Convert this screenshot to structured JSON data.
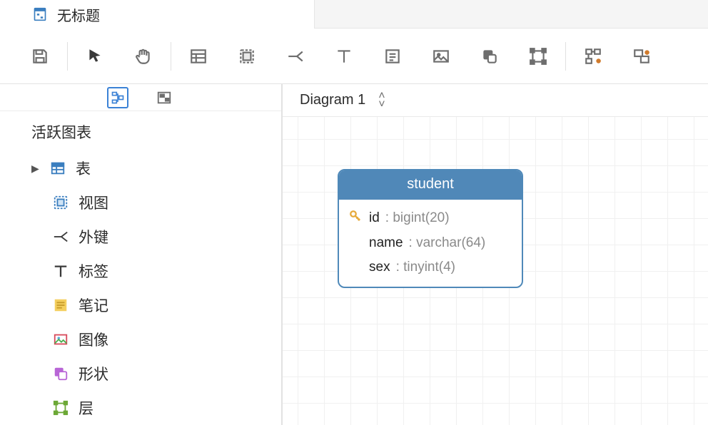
{
  "tab": {
    "title": "无标题"
  },
  "toolbar": {
    "items": [
      "save",
      "pointer",
      "hand",
      "table",
      "group",
      "relation",
      "text",
      "note",
      "image",
      "shape",
      "layer",
      "snap",
      "guides"
    ]
  },
  "sidebar": {
    "title": "活跃图表",
    "items": [
      {
        "label": "表",
        "icon": "table-icon",
        "caret": true
      },
      {
        "label": "视图",
        "icon": "view-icon",
        "caret": false
      },
      {
        "label": "外键",
        "icon": "fk-icon",
        "caret": false
      },
      {
        "label": "标签",
        "icon": "label-icon",
        "caret": false
      },
      {
        "label": "笔记",
        "icon": "note-icon",
        "caret": false
      },
      {
        "label": "图像",
        "icon": "image-icon",
        "caret": false
      },
      {
        "label": "形状",
        "icon": "shape-icon",
        "caret": false
      },
      {
        "label": "层",
        "icon": "layer-icon",
        "caret": false
      }
    ]
  },
  "canvas": {
    "diagram_label": "Diagram 1",
    "entity": {
      "name": "student",
      "columns": [
        {
          "pk": true,
          "name": "id",
          "type": "bigint(20)"
        },
        {
          "pk": false,
          "name": "name",
          "type": "varchar(64)"
        },
        {
          "pk": false,
          "name": "sex",
          "type": "tinyint(4)"
        }
      ]
    }
  }
}
